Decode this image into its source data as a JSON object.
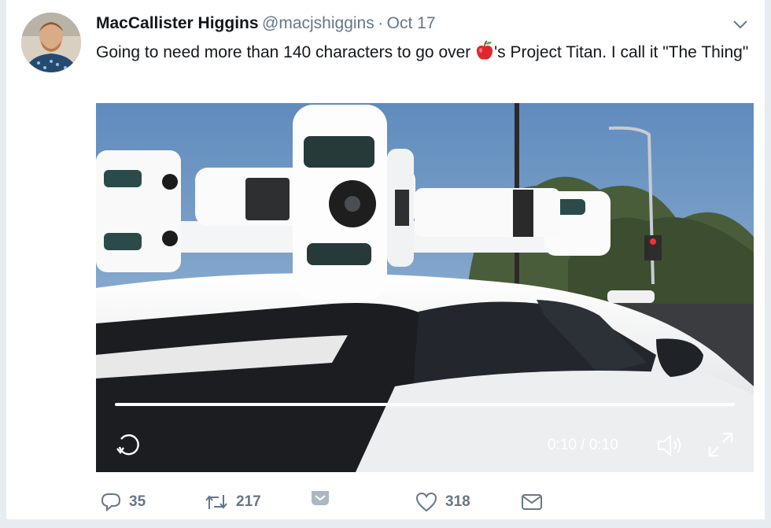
{
  "tweet": {
    "author_name": "MacCallister Higgins",
    "handle": "@macjshiggins",
    "separator": "·",
    "date": "Oct 17",
    "text_before": "Going to need more than 140 characters to go over ",
    "text_after": "'s Project Titan. I call it \"The Thing\""
  },
  "video": {
    "time_display": "0:10 / 0:10",
    "progress": 1.0
  },
  "actions": {
    "replies": "35",
    "retweets": "217",
    "likes": "318"
  },
  "icons": {
    "menu": "chevron-down-icon",
    "emoji": "red-apple-emoji",
    "replay": "replay-icon",
    "volume": "volume-icon",
    "fullscreen": "fullscreen-icon",
    "reply": "reply-icon",
    "retweet": "retweet-icon",
    "dm": "direct-message-icon",
    "like": "heart-icon",
    "share": "envelope-icon"
  },
  "colors": {
    "text": "#14171a",
    "muted": "#657786",
    "page_bg": "#e6ecf0"
  }
}
